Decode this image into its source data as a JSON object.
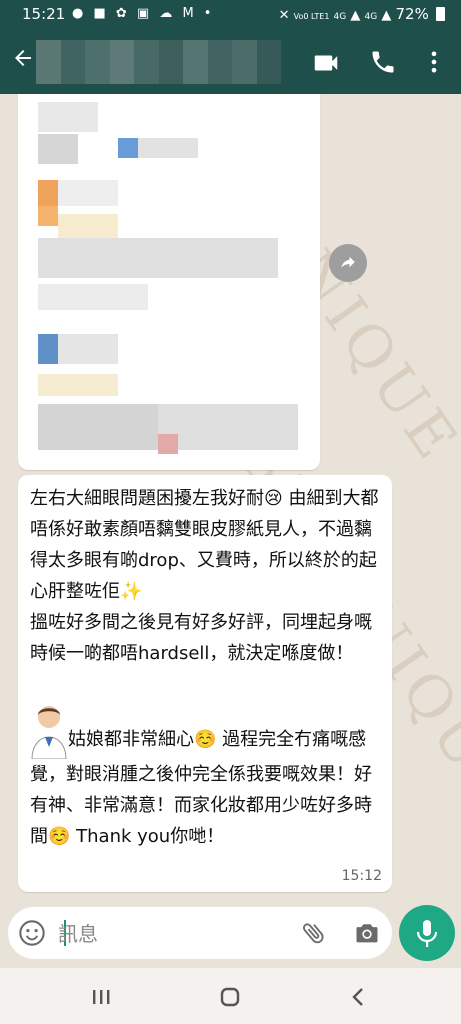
{
  "status_bar": {
    "time": "15:21",
    "network": "Vo0 LTE1",
    "signal_1": "4G",
    "signal_2": "4G",
    "battery": "72%"
  },
  "app_bar": {
    "back_icon": "arrow-left-icon",
    "contact_name_redacted": true,
    "icons": [
      "video-call-icon",
      "phone-icon",
      "more-vert-icon"
    ]
  },
  "watermark": "BEAUNIQUE",
  "image_message": {
    "forward_icon": "share-icon"
  },
  "text_message": {
    "paragraph_1": "左右大細眼問題困擾左我好耐😢 由細到大都唔係好敢素顏唔黐雙眼皮膠紙見人，不過黐得太多眼有啲drop、又費時，所以終於的起心肝整咗佢✨",
    "paragraph_2": "搵咗好多間之後見有好多好評，同埋起身嘅時候一啲都唔hardsell，就決定喺度做！",
    "paragraph_3": "姑娘都非常細心☺️ 過程完全冇痛嘅感覺，對眼消腫之後仲完全係我要嘅效果！好有神、非常滿意！而家化妝都用少咗好多時間☺️ Thank you你哋！",
    "time": "15:12"
  },
  "input_bar": {
    "placeholder": "訊息",
    "icons": [
      "emoji-icon",
      "attach-icon",
      "camera-icon",
      "mic-icon"
    ]
  },
  "nav_bar": {
    "icons": [
      "recents-icon",
      "home-icon",
      "back-icon"
    ]
  },
  "colors": {
    "header": "#1f4f4b",
    "accent": "#1ea884",
    "bubble": "#ffffff",
    "wallpaper": "#e9e2d8"
  }
}
